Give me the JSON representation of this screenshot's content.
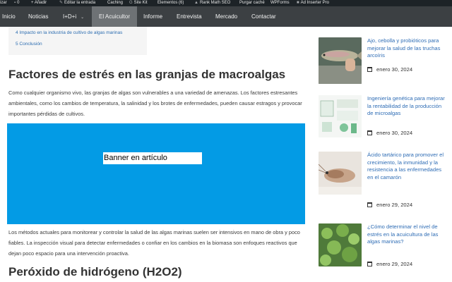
{
  "admin_bar": {
    "items": [
      "izar",
      "0",
      "+ Añadir",
      "Editar la entrada",
      "Caching",
      "Site Kit",
      "Elementos (6)",
      "Rank Math SEO",
      "Purgar caché",
      "WPForms",
      "Ad Inserter Pro"
    ]
  },
  "nav": {
    "items": [
      "Inicio",
      "Noticias",
      "I+D+i",
      "El Acuicultor",
      "Informe",
      "Entrevista",
      "Mercado",
      "Contactar"
    ],
    "active": "El Acuicultor"
  },
  "toc": {
    "items": [
      "4 Impacto en la industria de cultivo de algas marinas",
      "5 Conclusión"
    ]
  },
  "article": {
    "heading1": "Factores de estrés en las granjas de macroalgas",
    "para1": "Como cualquier organismo vivo, las granjas de algas son vulnerables a una variedad de amenazas. Los factores estresantes ambientales, como los cambios de temperatura, la salinidad y los brotes de enfermedades, pueden causar estragos y provocar importantes pérdidas de cultivos.",
    "banner_label": "Banner en artículo",
    "para2": "Los métodos actuales para monitorear y controlar la salud de las algas marinas suelen ser intensivos en mano de obra y poco fiables. La inspección visual para detectar enfermedades o confiar en los cambios en la biomasa son enfoques reactivos que dejan poco espacio para una intervención proactiva.",
    "heading2": "Peróxido de hidrógeno (H2O2)"
  },
  "sidebar": {
    "posts": [
      {
        "title": "Ajo, cebolla y probióticos para mejorar la salud de las truchas arcoíris",
        "date": "enero 30, 2024"
      },
      {
        "title": "Ingeniería genética para mejorar la rentabilidad de la producción de microalgas",
        "date": "enero 30, 2024"
      },
      {
        "title": "Ácido tartárico para promover el crecimiento, la inmunidad y la resistencia a las enfermedades en el camarón",
        "date": "enero 29, 2024"
      },
      {
        "title": "¿Cómo determinar el nivel de estrés en la acuicultura de las algas marinas?",
        "date": "enero 29, 2024"
      }
    ]
  },
  "colors": {
    "admin_bar": "#1d2327",
    "nav": "#3c4043",
    "nav_active": "#6e7275",
    "banner": "#039be5",
    "link": "#2f6db5"
  }
}
